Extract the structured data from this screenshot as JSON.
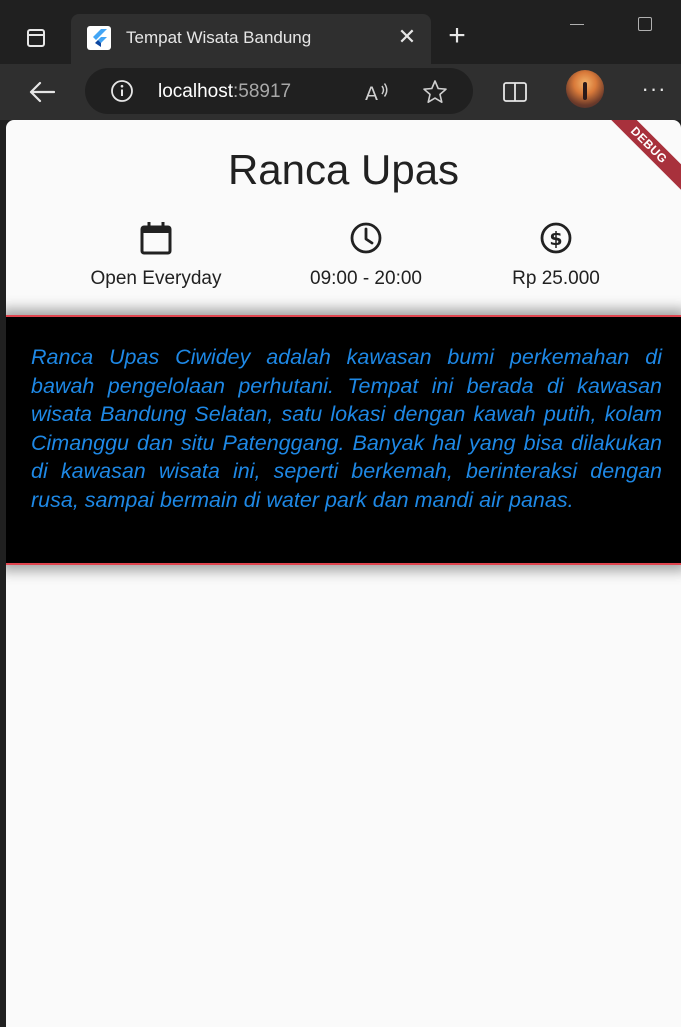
{
  "browser": {
    "tab_title": "Tempat Wisata Bandung",
    "url_host": "localhost",
    "url_port": ":58917",
    "new_tab_symbol": "+",
    "close_tab_symbol": "✕",
    "more_symbol": "···"
  },
  "page": {
    "debug_label": "DEBUG",
    "title": "Ranca Upas",
    "info": [
      {
        "icon": "calendar-icon",
        "label": "Open Everyday"
      },
      {
        "icon": "clock-icon",
        "label": "09:00 - 20:00"
      },
      {
        "icon": "dollar-icon",
        "label": "Rp 25.000"
      }
    ],
    "description": "Ranca Upas Ciwidey adalah kawasan bumi perkemahan di bawah pengelolaan perhutani. Tempat ini berada di kawasan wisata Bandung Selatan, satu lokasi dengan kawah putih, kolam Cimanggu dan situ Patenggang. Banyak hal yang bisa dilakukan di kawasan wisata ini, seperti berkemah, berinteraksi dengan rusa, sampai bermain di water park dan mandi air panas."
  },
  "colors": {
    "description_text": "#1e88e5",
    "description_bg": "#000000",
    "description_border": "#e0454f",
    "debug_ribbon": "#a8313c"
  }
}
